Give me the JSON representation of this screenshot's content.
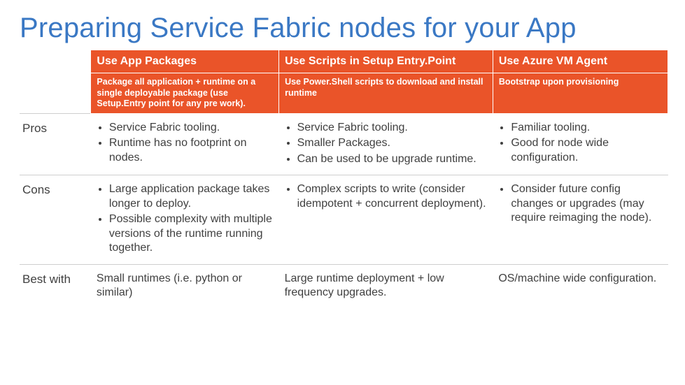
{
  "title": "Preparing Service Fabric nodes for your App",
  "columns": {
    "c1": {
      "header": "Use App Packages",
      "sub": "Package all application + runtime on a single deployable package (use Setup.Entry point for any pre work)."
    },
    "c2": {
      "header": "Use Scripts in Setup Entry.Point",
      "sub": "Use Power.Shell scripts to download and install runtime"
    },
    "c3": {
      "header": "Use Azure VM Agent",
      "sub": "Bootstrap upon provisioning"
    }
  },
  "rows": {
    "pros": {
      "label": "Pros",
      "c1": [
        "Service Fabric tooling.",
        "Runtime has no footprint on nodes."
      ],
      "c2": [
        "Service Fabric tooling.",
        "Smaller Packages.",
        "Can be used to be upgrade runtime."
      ],
      "c3": [
        "Familiar tooling.",
        "Good for node wide configuration."
      ]
    },
    "cons": {
      "label": "Cons",
      "c1": [
        "Large application package takes longer to deploy.",
        "Possible complexity with multiple versions of the runtime running together."
      ],
      "c2": [
        "Complex scripts to write (consider idempotent + concurrent deployment)."
      ],
      "c3": [
        "Consider future config changes or upgrades (may require reimaging the node)."
      ]
    },
    "best": {
      "label": "Best with",
      "c1": "Small runtimes (i.e. python or similar)",
      "c2": "Large runtime deployment + low frequency upgrades.",
      "c3": "OS/machine wide configuration."
    }
  }
}
